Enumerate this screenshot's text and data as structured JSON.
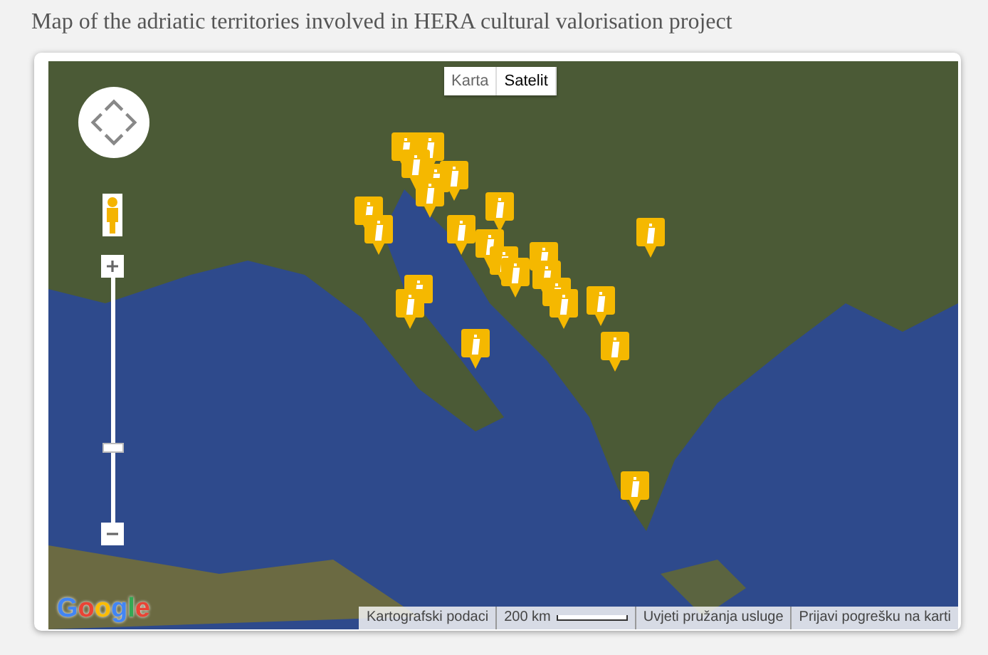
{
  "heading": "Map of the adriatic territories involved in HERA cultural valorisation project",
  "map_types": [
    {
      "label": "Karta",
      "selected": false
    },
    {
      "label": "Satelit",
      "selected": true
    }
  ],
  "zoom": {
    "level": 0.3
  },
  "logo": "Google",
  "footer": {
    "map_data": "Kartografski podaci",
    "scale": "200 km",
    "terms": "Uvjeti pružanja usluge",
    "report": "Prijavi pogrešku na karti"
  }
}
